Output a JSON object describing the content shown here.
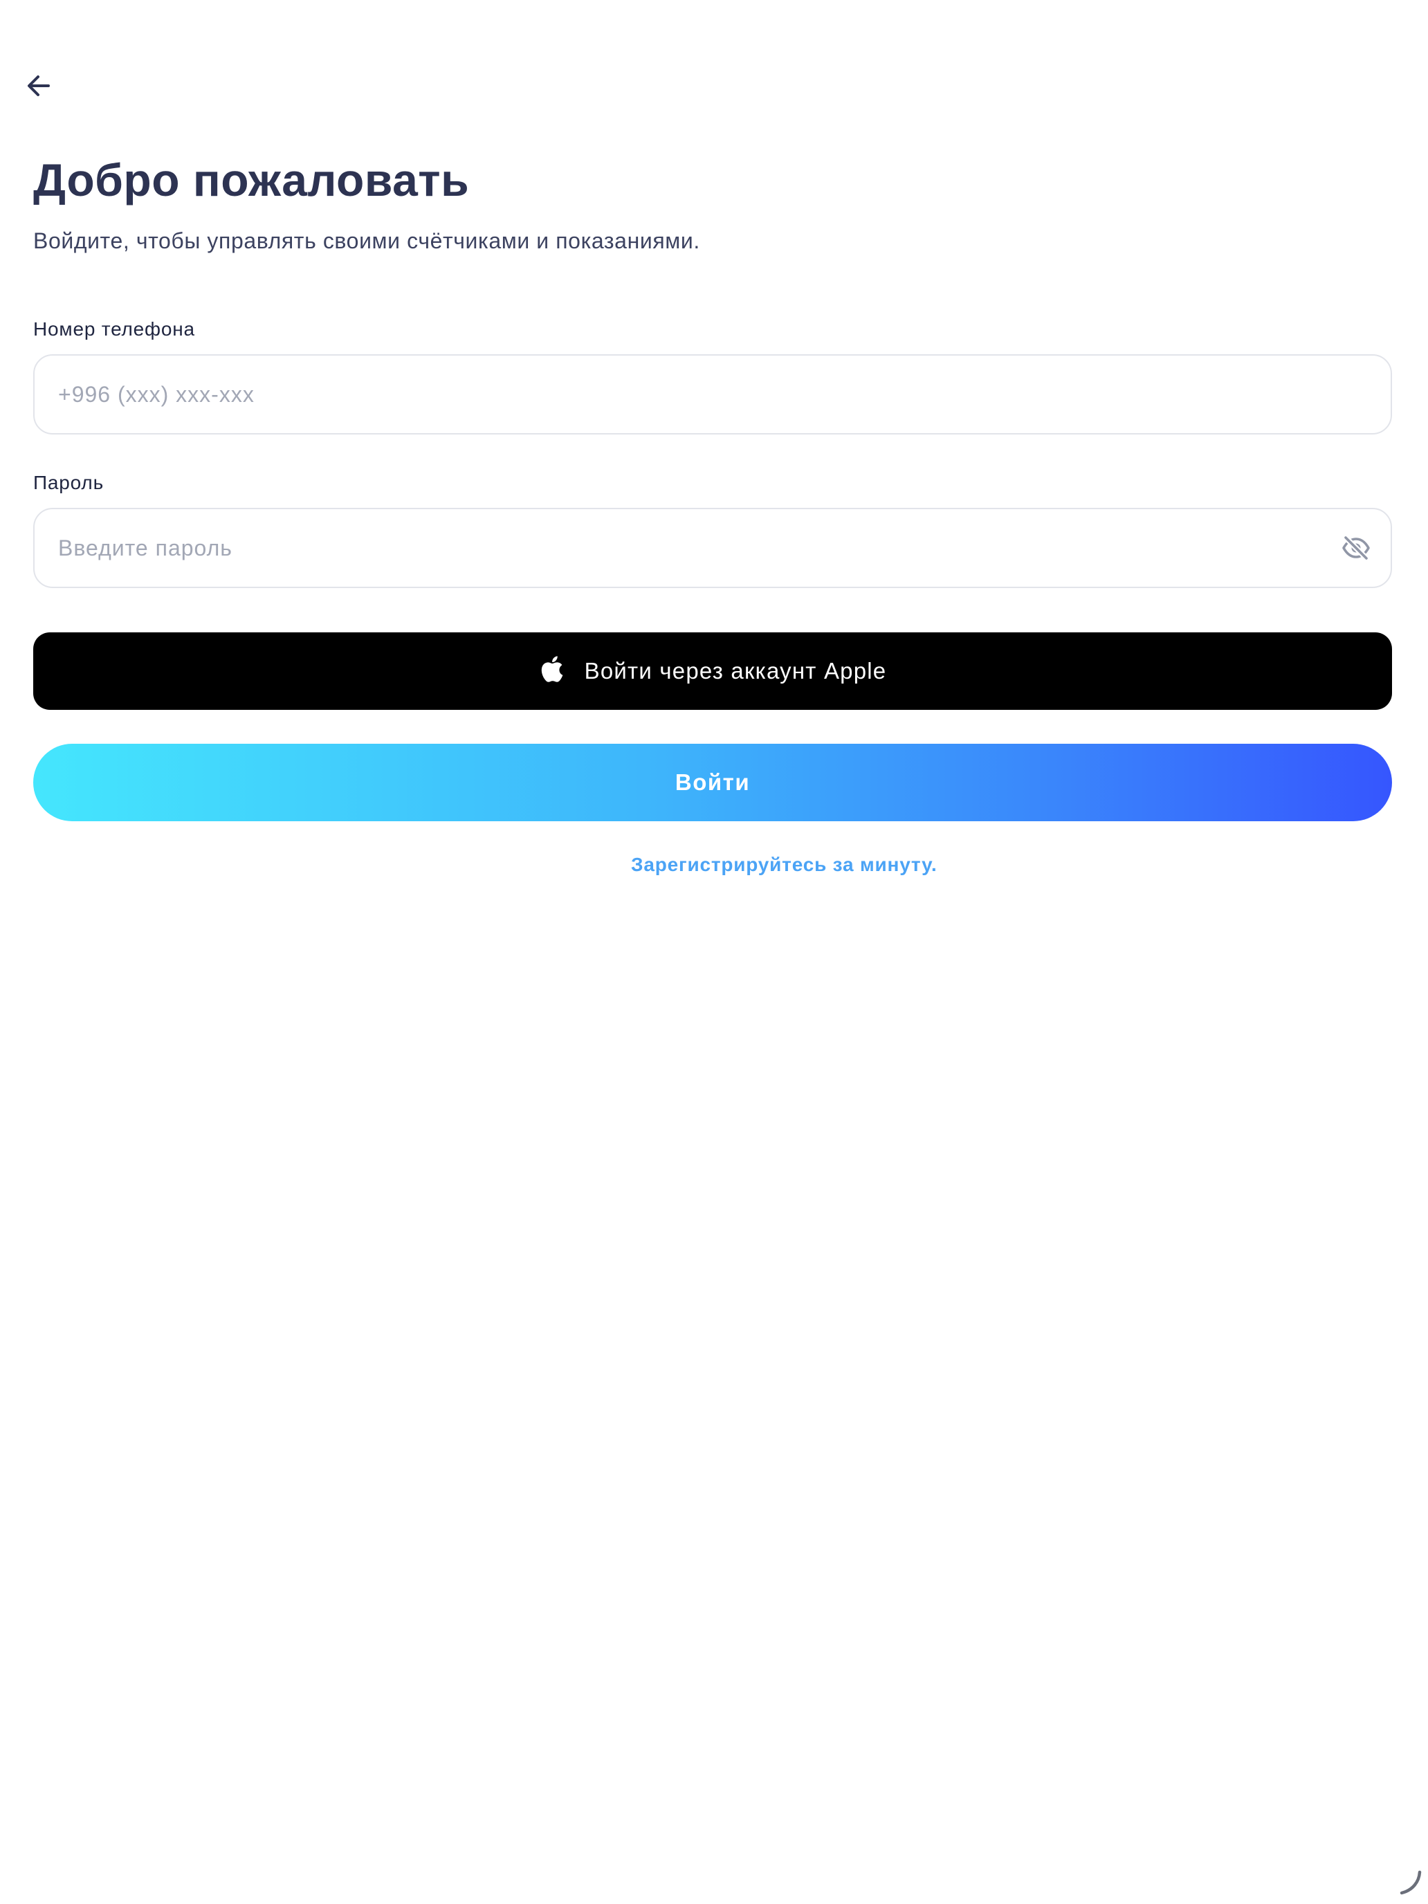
{
  "header": {
    "back_icon": "arrow-left-icon"
  },
  "welcome": {
    "title": "Добро пожаловать",
    "subtitle": "Войдите, чтобы управлять своими счётчиками и показаниями."
  },
  "form": {
    "phone": {
      "label": "Номер телефона",
      "placeholder": "+996 (xxx) xxx-xxx",
      "value": ""
    },
    "password": {
      "label": "Пароль",
      "placeholder": "Введите пароль",
      "value": "",
      "toggle_icon": "eye-off-icon"
    }
  },
  "actions": {
    "apple_label": "Войти через аккаунт Apple",
    "apple_icon": "apple-logo-icon",
    "login_label": "Войти",
    "register_link": "Зарегистрируйтесь за минуту."
  },
  "colors": {
    "title": "#2d3352",
    "apple_button": "#000000",
    "gradient_start": "#45e6fd",
    "gradient_end": "#3656fe",
    "link": "#4ba3f5",
    "placeholder": "#a2a7b5",
    "field_border": "#e2e4ea"
  }
}
